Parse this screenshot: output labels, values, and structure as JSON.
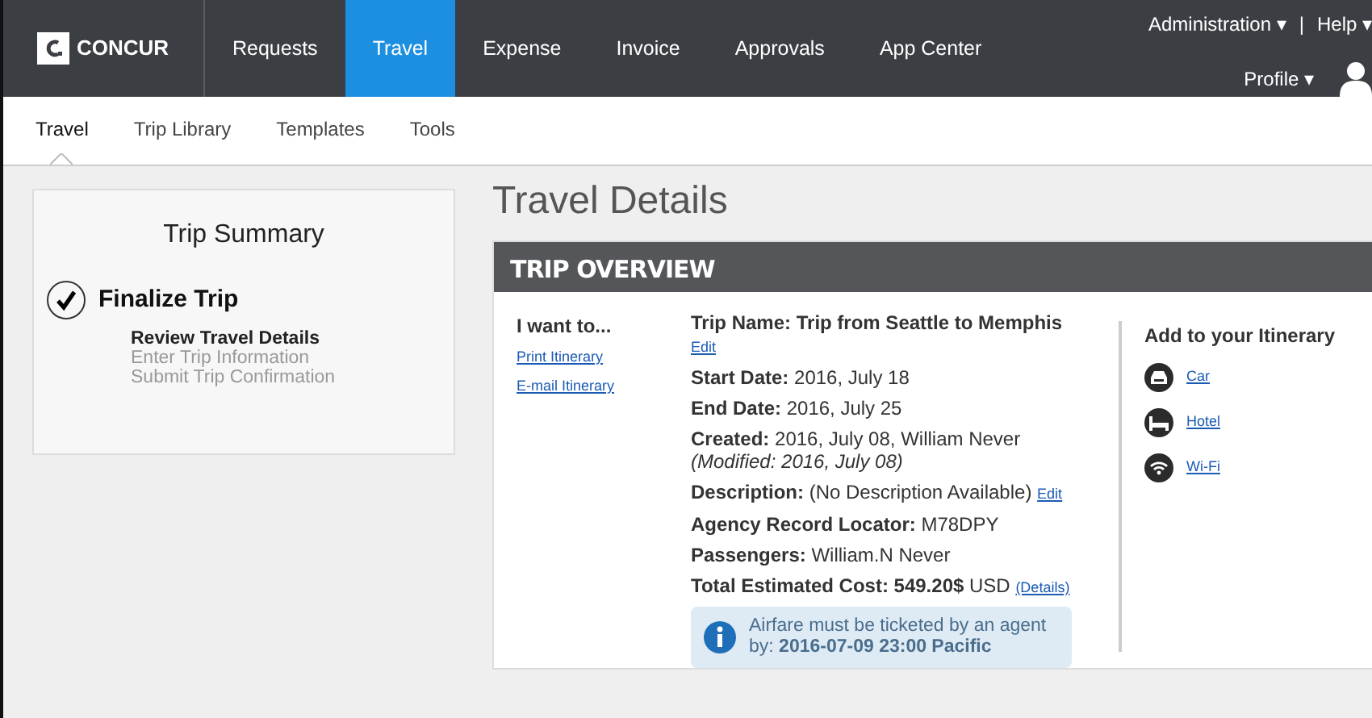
{
  "logo": {
    "text": "CONCUR"
  },
  "nav": [
    {
      "label": "Requests",
      "selected": false
    },
    {
      "label": "Travel",
      "selected": true
    },
    {
      "label": "Expense",
      "selected": false
    },
    {
      "label": "Invoice",
      "selected": false
    },
    {
      "label": "Approvals",
      "selected": false
    },
    {
      "label": "App Center",
      "selected": false
    }
  ],
  "top_right": {
    "admin": "Administration ▾",
    "separator": "|",
    "help": "Help ▾",
    "profile": "Profile ▾"
  },
  "subnav": [
    {
      "label": "Travel",
      "selected": true
    },
    {
      "label": "Trip Library",
      "selected": false
    },
    {
      "label": "Templates",
      "selected": false
    },
    {
      "label": "Tools",
      "selected": false
    }
  ],
  "summary": {
    "title": "Trip Summary",
    "step": "Finalize Trip",
    "checked": true,
    "substeps": [
      {
        "label": "Review Travel Details",
        "current": true
      },
      {
        "label": "Enter Trip Information",
        "current": false
      },
      {
        "label": "Submit Trip Confirmation",
        "current": false
      }
    ]
  },
  "page_title": "Travel Details",
  "overview": {
    "header": "TRIP OVERVIEW",
    "actions_title": "I want to...",
    "actions": [
      "Print Itinerary",
      "E-mail Itinerary"
    ],
    "details": [
      {
        "text": "Trip Name: Trip from Seattle to Memphis",
        "bold": true,
        "link": "Edit",
        "link_below": true
      },
      {
        "text": "**Start Date:** 2016, July 18",
        "bold": false
      },
      {
        "text": "**End Date:** 2016, July 25",
        "bold": false
      },
      {
        "text": "**Created:** 2016, July 08, William Never",
        "bold": false,
        "note": "(Modified: 2016, July 08)"
      },
      {
        "text": "**Description:** (No Description Available)",
        "bold": false,
        "link": "Edit",
        "link_below": false
      },
      {
        "text": "**Agency Record Locator:** M78DPY",
        "bold": false
      },
      {
        "text": "**Passengers:** William.N Never",
        "bold": false
      },
      {
        "text": "**Total Estimated Cost: 549.20$** USD",
        "bold": false,
        "link": "(Details)",
        "link_below": false
      }
    ],
    "notice": "Airfare must be ticketed by an agent by: **2016-07-09 23:00 Pacific**",
    "add_title": "Add to your Itinerary",
    "add_items": [
      {
        "kind": "car",
        "label": "Car"
      },
      {
        "kind": "hotel",
        "label": "Hotel"
      },
      {
        "kind": "wifi",
        "label": "Wi-Fi"
      }
    ]
  }
}
